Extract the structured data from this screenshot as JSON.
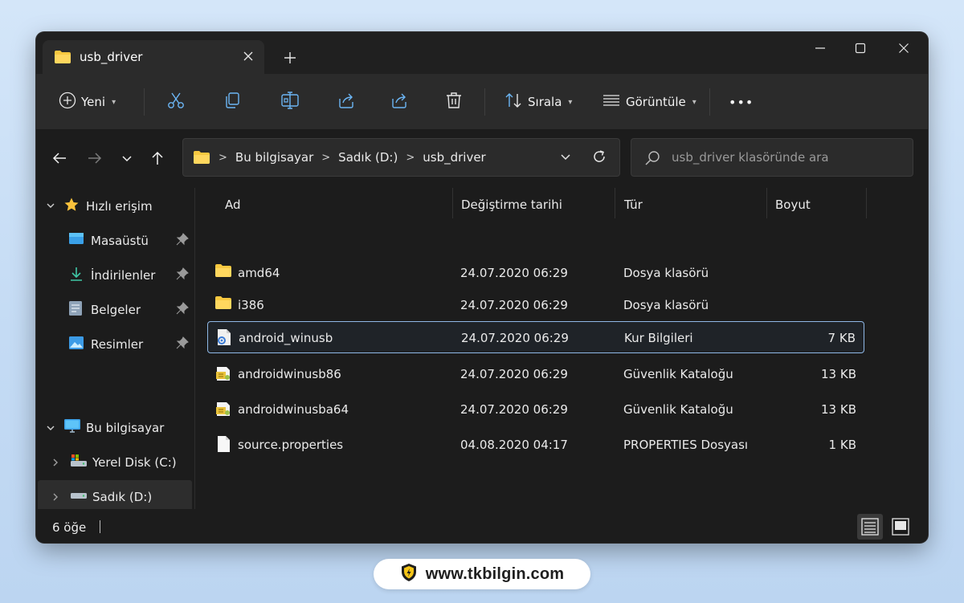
{
  "window": {
    "tab_title": "usb_driver",
    "new_tab_symbol": "+"
  },
  "toolbar": {
    "new_label": "Yeni",
    "sort_label": "Sırala",
    "view_label": "Görüntüle",
    "more_symbol": "•••"
  },
  "address": {
    "crumbs": [
      "Bu bilgisayar",
      "Sadık (D:)",
      "usb_driver"
    ],
    "separator": ">"
  },
  "search": {
    "placeholder": "usb_driver klasöründe ara"
  },
  "sidebar": {
    "items": [
      {
        "label": "Hızlı erişim",
        "icon": "star-icon"
      },
      {
        "label": "Masaüstü",
        "icon": "desktop-icon"
      },
      {
        "label": "İndirilenler",
        "icon": "download-icon"
      },
      {
        "label": "Belgeler",
        "icon": "documents-icon"
      },
      {
        "label": "Resimler",
        "icon": "pictures-icon"
      },
      {
        "label": "Bu bilgisayar",
        "icon": "computer-icon"
      },
      {
        "label": "Yerel Disk (C:)",
        "icon": "disk-c-icon"
      },
      {
        "label": "Sadık (D:)",
        "icon": "disk-d-icon"
      }
    ]
  },
  "files": {
    "headers": [
      "Ad",
      "Değiştirme tarihi",
      "Tür",
      "Boyut"
    ],
    "rows": [
      {
        "name": "amd64",
        "date": "24.07.2020 06:29",
        "type": "Dosya klasörü",
        "size": "",
        "icon": "folder-icon"
      },
      {
        "name": "i386",
        "date": "24.07.2020 06:29",
        "type": "Dosya klasörü",
        "size": "",
        "icon": "folder-icon"
      },
      {
        "name": "android_winusb",
        "date": "24.07.2020 06:29",
        "type": "Kur Bilgileri",
        "size": "7 KB",
        "icon": "setup-info-icon"
      },
      {
        "name": "androidwinusb86",
        "date": "24.07.2020 06:29",
        "type": "Güvenlik Kataloğu",
        "size": "13 KB",
        "icon": "security-catalog-icon"
      },
      {
        "name": "androidwinusba64",
        "date": "24.07.2020 06:29",
        "type": "Güvenlik Kataloğu",
        "size": "13 KB",
        "icon": "security-catalog-icon"
      },
      {
        "name": "source.properties",
        "date": "04.08.2020 04:17",
        "type": "PROPERTIES Dosyası",
        "size": "1 KB",
        "icon": "file-icon"
      }
    ]
  },
  "status": {
    "count": "6 öğe"
  },
  "watermark": {
    "text": "www.tkbilgin.com"
  },
  "colors": {
    "window_bg": "#1c1c1c",
    "toolbar_bg": "#2b2b2b",
    "accent_selection": "#8fb8e6",
    "folder_yellow": "#f8c840",
    "page_bg": "#c9def5"
  }
}
